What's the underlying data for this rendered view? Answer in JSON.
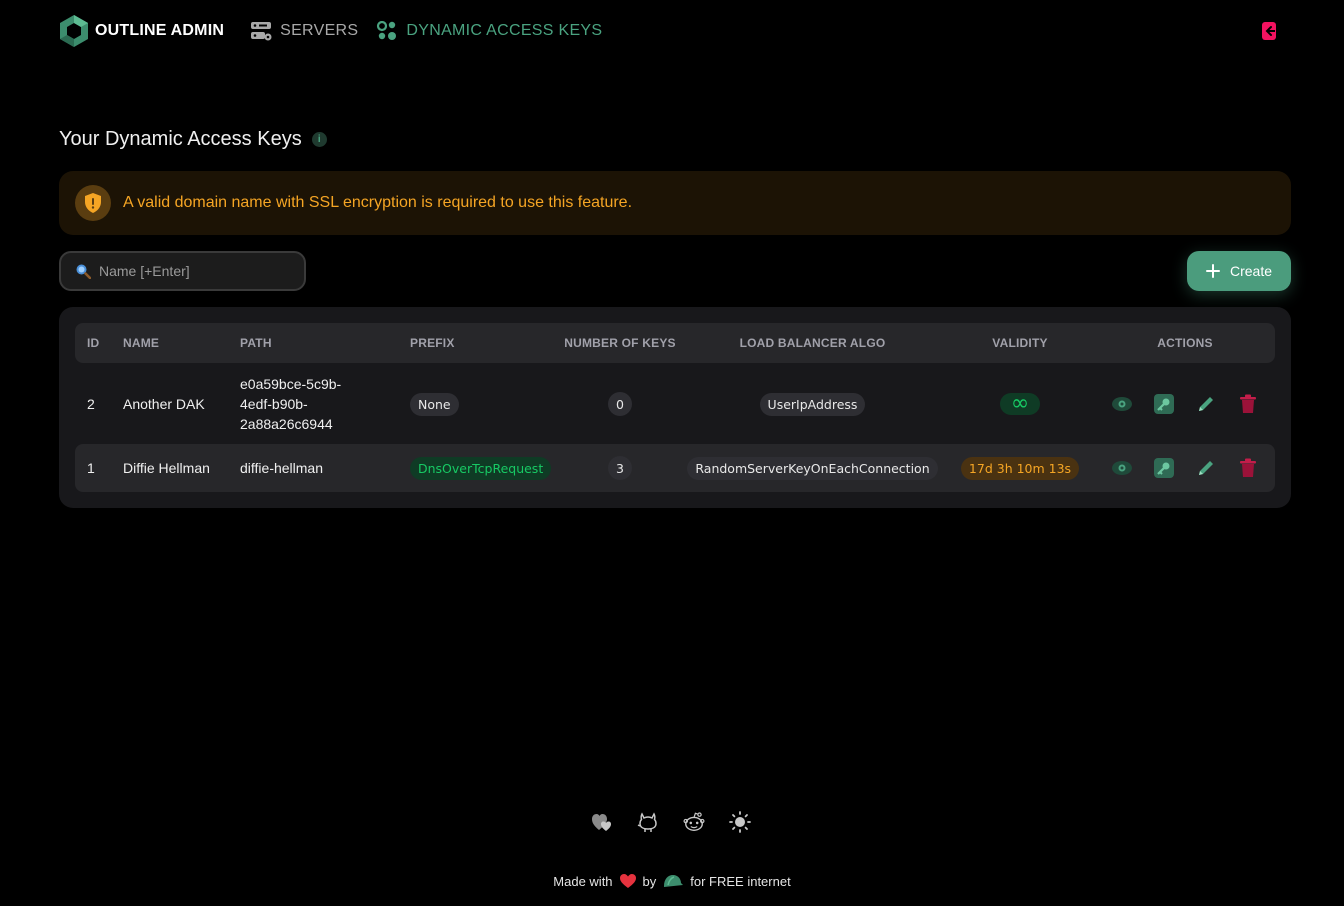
{
  "nav": {
    "brand": "OUTLINE ADMIN",
    "links": [
      {
        "label": "SERVERS",
        "icon": "servers-icon"
      },
      {
        "label": "DYNAMIC ACCESS KEYS",
        "icon": "dynamic-keys-icon",
        "active": true
      }
    ],
    "logout_icon": "logout-icon"
  },
  "page": {
    "title": "Your Dynamic Access Keys",
    "info_symbol": "i"
  },
  "alert": {
    "text": "A valid domain name with SSL encryption is required to use this feature.",
    "icon": "shield-warning-icon"
  },
  "search": {
    "placeholder": "Name [+Enter]",
    "value": ""
  },
  "create_button": {
    "label": "Create",
    "icon": "plus-icon"
  },
  "table": {
    "headers": [
      "ID",
      "NAME",
      "PATH",
      "PREFIX",
      "NUMBER OF KEYS",
      "LOAD BALANCER ALGO",
      "VALIDITY",
      "ACTIONS"
    ],
    "rows": [
      {
        "id": "2",
        "name": "Another DAK",
        "path_lines": [
          "e0a59bce-5c9b-",
          "4edf-b90b-",
          "2a88a26c6944"
        ],
        "prefix": "None",
        "num_keys": "0",
        "lb_algo": "UserIpAddress",
        "validity": "∞"
      },
      {
        "id": "1",
        "name": "Diffie Hellman",
        "path_lines": [
          "diffie-hellman"
        ],
        "prefix": "DnsOverTcpRequest",
        "num_keys": "3",
        "lb_algo": "RandomServerKeyOnEachConnection",
        "validity": "17d 3h 10m 13s"
      }
    ],
    "actions": [
      "view-icon",
      "key-icon",
      "edit-icon",
      "delete-icon"
    ]
  },
  "footer": {
    "icons": [
      "donate-heart-icon",
      "github-icon",
      "reddit-icon",
      "theme-sun-icon"
    ],
    "credit_made_with": "Made with",
    "credit_by": "by",
    "credit_for": "for FREE internet"
  },
  "colors": {
    "accent": "#4aa380",
    "warning": "#f5a524",
    "success": "#17c964",
    "danger": "#c31d4a",
    "logout": "#f31260"
  }
}
